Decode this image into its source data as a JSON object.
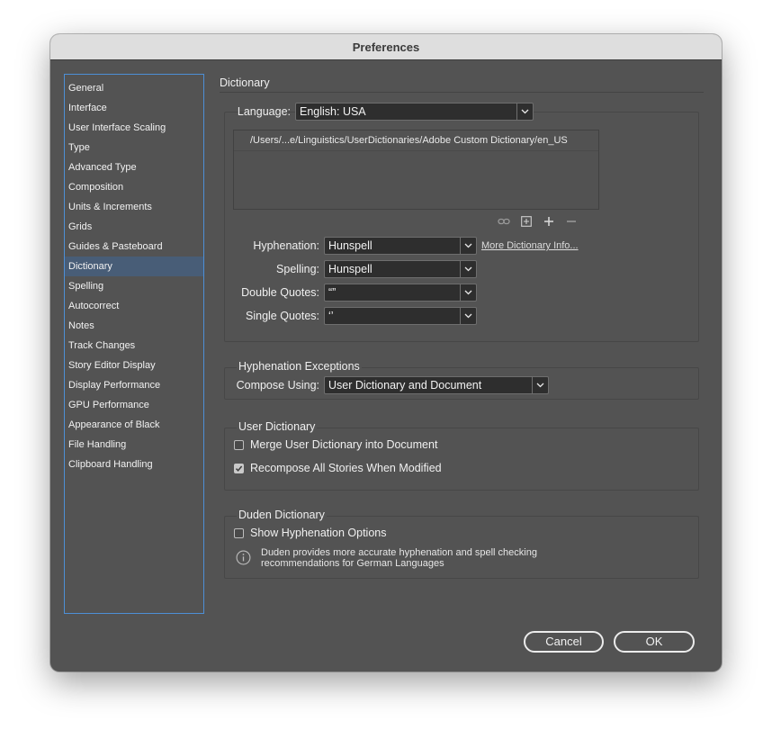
{
  "window": {
    "title": "Preferences"
  },
  "sidebar": {
    "items": [
      {
        "label": "General"
      },
      {
        "label": "Interface"
      },
      {
        "label": "User Interface Scaling"
      },
      {
        "label": "Type"
      },
      {
        "label": "Advanced Type"
      },
      {
        "label": "Composition"
      },
      {
        "label": "Units & Increments"
      },
      {
        "label": "Grids"
      },
      {
        "label": "Guides & Pasteboard"
      },
      {
        "label": "Dictionary",
        "selected": true
      },
      {
        "label": "Spelling"
      },
      {
        "label": "Autocorrect"
      },
      {
        "label": "Notes"
      },
      {
        "label": "Track Changes"
      },
      {
        "label": "Story Editor Display"
      },
      {
        "label": "Display Performance"
      },
      {
        "label": "GPU Performance"
      },
      {
        "label": "Appearance of Black"
      },
      {
        "label": "File Handling"
      },
      {
        "label": "Clipboard Handling"
      }
    ]
  },
  "dictionary": {
    "title": "Dictionary",
    "language_label": "Language:",
    "language_value": "English: USA",
    "dictionary_paths": [
      "/Users/...e/Linguistics/UserDictionaries/Adobe Custom Dictionary/en_US"
    ],
    "hyphenation_label": "Hyphenation:",
    "hyphenation_value": "Hunspell",
    "more_info_link": "More Dictionary Info...",
    "spelling_label": "Spelling:",
    "spelling_value": "Hunspell",
    "double_quotes_label": "Double Quotes:",
    "double_quotes_value": "“”",
    "single_quotes_label": "Single Quotes:",
    "single_quotes_value": "‘’"
  },
  "hyphenation_exceptions": {
    "title": "Hyphenation Exceptions",
    "compose_label": "Compose Using:",
    "compose_value": "User Dictionary and Document"
  },
  "user_dictionary": {
    "title": "User Dictionary",
    "merge_label": "Merge User Dictionary into Document",
    "merge_checked": false,
    "recompose_label": "Recompose All Stories When Modified",
    "recompose_checked": true
  },
  "duden_dictionary": {
    "title": "Duden Dictionary",
    "show_label": "Show Hyphenation Options",
    "show_checked": false,
    "info_text": "Duden provides more accurate hyphenation and spell checking recommendations for German Languages"
  },
  "buttons": {
    "cancel": "Cancel",
    "ok": "OK"
  },
  "colors": {
    "panel": "#535353",
    "field": "#2e2e2e",
    "selection": "#485d77",
    "focus_border": "#4d8fd6"
  }
}
